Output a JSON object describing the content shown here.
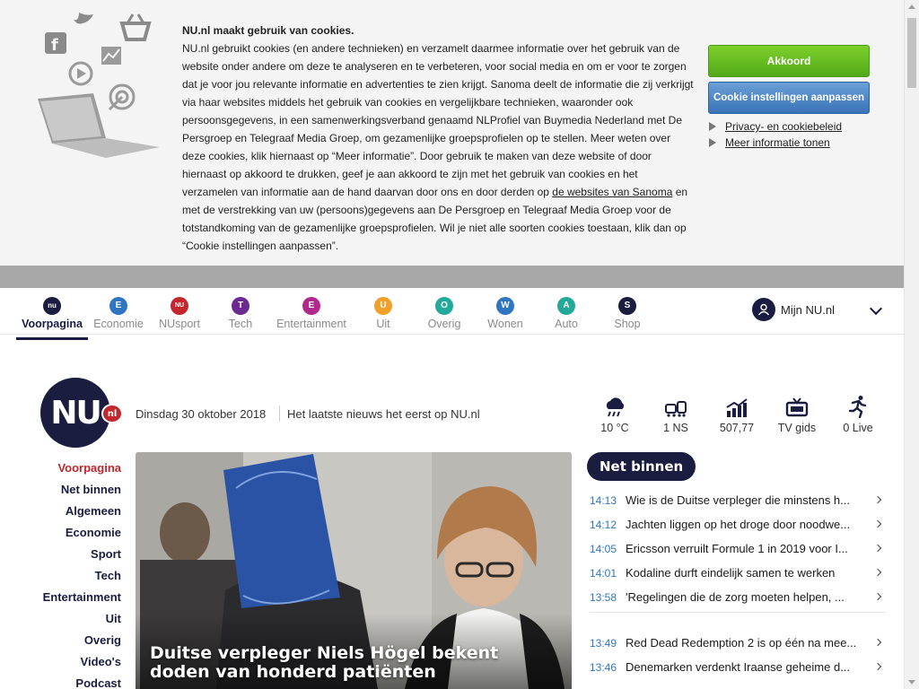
{
  "cookie": {
    "title": "NU.nl maakt gebruik van cookies.",
    "text_1": "NU.nl gebruikt cookies (en andere technieken) en verzamelt daarmee informatie over het gebruik van de website onder andere om deze te analyseren en te verbeteren, voor social media en om er voor te zorgen dat je voor jou relevante informatie en advertenties te zien krijgt. Sanoma deelt de informatie die zij verkrijgt via haar websites middels het gebruik van cookies en vergelijkbare technieken, waaronder ook persoonsgegevens, in een samenwerkingsverband genaamd NLProfiel van Buymedia Nederland met De Persgroep en Telegraaf Media Groep, om gezamenlijke groepsprofielen op te stellen. Meer weten over deze cookies, klik hiernaast op “Meer informatie”. Door gebruik te maken van deze website of door hiernaast op akkoord te drukken, geef je aan akkoord te zijn met het gebruik van cookies en het verzamelen van informatie aan de hand daarvan door ons en door derden op ",
    "link_text": "de websites van Sanoma",
    "text_2": " en met de verstrekking van uw (persoons)gegevens aan De Persgroep en Telegraaf Media Groep voor de totstandkoming van de gezamenlijke groepsprofielen. Wil je niet alle soorten cookies toestaan, klik dan op “Cookie instellingen aanpassen”.",
    "accept_label": "Akkoord",
    "settings_label": "Cookie instellingen aanpassen",
    "link_privacy": "Privacy- en cookiebeleid",
    "link_more": "Meer informatie tonen"
  },
  "nav": {
    "items": [
      {
        "label": "Voorpagina",
        "glyph": "nu",
        "color": "#1a1d3f"
      },
      {
        "label": "Economie",
        "glyph": "E",
        "color": "#2e76c2"
      },
      {
        "label": "NUsport",
        "glyph": "NU",
        "color": "#c1272d"
      },
      {
        "label": "Tech",
        "glyph": "T",
        "color": "#6b2a8f"
      },
      {
        "label": "Entertainment",
        "glyph": "E",
        "color": "#b02a8e"
      },
      {
        "label": "Uit",
        "glyph": "U",
        "color": "#f0a02a"
      },
      {
        "label": "Overig",
        "glyph": "O",
        "color": "#23a99a"
      },
      {
        "label": "Wonen",
        "glyph": "W",
        "color": "#2e76c2"
      },
      {
        "label": "Auto",
        "glyph": "A",
        "color": "#23a99a"
      },
      {
        "label": "Shop",
        "glyph": "S",
        "color": "#1a1d3f"
      }
    ],
    "mijn_label": "Mijn NU.nl"
  },
  "header": {
    "logo_text": "NU",
    "logo_badge": "nl",
    "date": "Dinsdag 30 oktober 2018",
    "tagline": "Het laatste nieuws het eerst op NU.nl",
    "widgets": [
      {
        "label": "10 °C",
        "icon": "rain-cloud-icon"
      },
      {
        "label": "1 NS",
        "icon": "train-icon"
      },
      {
        "label": "507,77",
        "icon": "stock-chart-icon"
      },
      {
        "label": "TV gids",
        "icon": "tv-icon"
      },
      {
        "label": "0 Live",
        "icon": "running-icon"
      }
    ]
  },
  "left_menu": [
    "Voorpagina",
    "Net binnen",
    "Algemeen",
    "Economie",
    "Sport",
    "Tech",
    "Entertainment",
    "Uit",
    "Overig",
    "Video's",
    "Podcast"
  ],
  "hero": {
    "title": "Duitse verpleger Niels Högel bekent doden van honderd patiënten"
  },
  "net_binnen": {
    "title": "Net binnen",
    "items": [
      {
        "time": "14:13",
        "headline": "Wie is de Duitse verpleger die minstens h..."
      },
      {
        "time": "14:12",
        "headline": "Jachten liggen op het droge door noodwe..."
      },
      {
        "time": "14:05",
        "headline": "Ericsson verruilt Formule 1 in 2019 voor I..."
      },
      {
        "time": "14:01",
        "headline": "Kodaline durft eindelijk samen te werken"
      },
      {
        "time": "13:58",
        "headline": "'Regelingen die de zorg moeten helpen, ..."
      },
      {
        "time": "13:49",
        "headline": "Red Dead Redemption 2 is op één na mee..."
      },
      {
        "time": "13:46",
        "headline": "Denemarken verdenkt Iraanse geheime d..."
      }
    ]
  }
}
